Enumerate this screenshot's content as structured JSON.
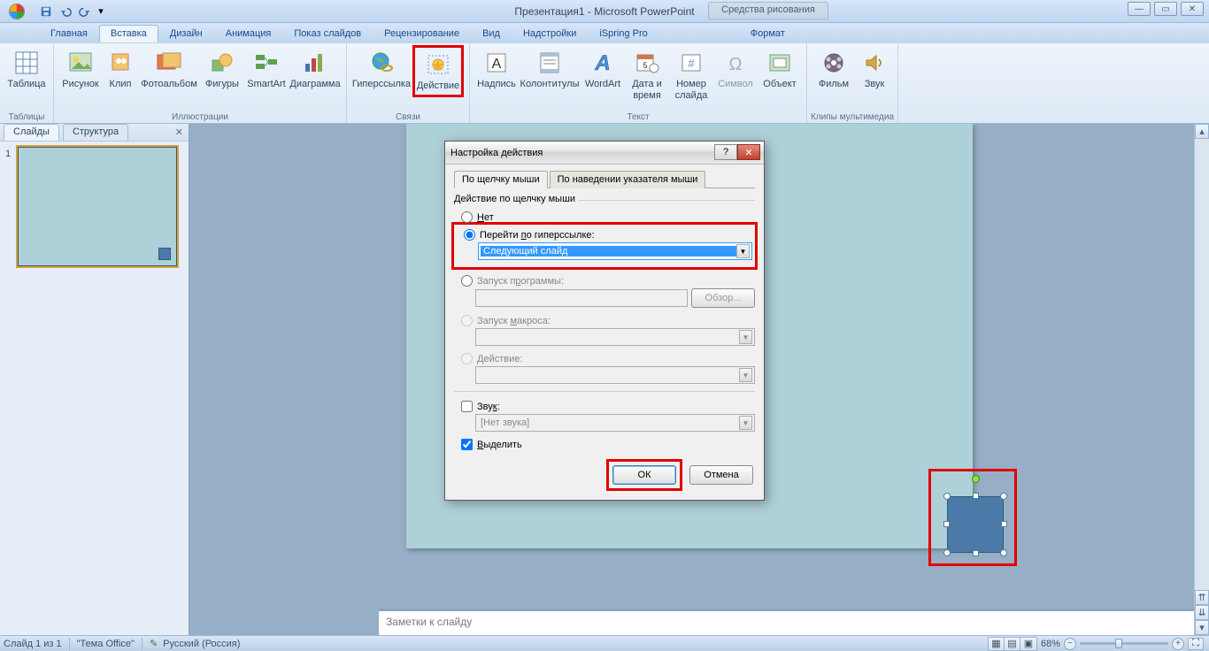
{
  "title": "Презентация1 - Microsoft PowerPoint",
  "tools_tab": "Средства рисования",
  "win": {
    "min": "—",
    "max": "▭",
    "close": "✕"
  },
  "tabs": [
    "Главная",
    "Вставка",
    "Дизайн",
    "Анимация",
    "Показ слайдов",
    "Рецензирование",
    "Вид",
    "Надстройки",
    "iSpring Pro",
    "Формат"
  ],
  "active_tab": 1,
  "ribbon": {
    "groups": [
      {
        "label": "Таблицы",
        "items": [
          {
            "name": "table",
            "label": "Таблица"
          }
        ]
      },
      {
        "label": "Иллюстрации",
        "items": [
          {
            "name": "picture",
            "label": "Рисунок"
          },
          {
            "name": "clip",
            "label": "Клип"
          },
          {
            "name": "photoalbum",
            "label": "Фотоальбом"
          },
          {
            "name": "shapes",
            "label": "Фигуры"
          },
          {
            "name": "smartart",
            "label": "SmartArt"
          },
          {
            "name": "chart",
            "label": "Диаграмма"
          }
        ]
      },
      {
        "label": "Связи",
        "items": [
          {
            "name": "hyperlink",
            "label": "Гиперссылка"
          },
          {
            "name": "action",
            "label": "Действие",
            "highlight": true
          }
        ]
      },
      {
        "label": "Текст",
        "items": [
          {
            "name": "textbox",
            "label": "Надпись"
          },
          {
            "name": "headerfooter",
            "label": "Колонтитулы"
          },
          {
            "name": "wordart",
            "label": "WordArt"
          },
          {
            "name": "datetime",
            "label": "Дата и время"
          },
          {
            "name": "slidenum",
            "label": "Номер слайда"
          },
          {
            "name": "symbol",
            "label": "Символ",
            "disabled": true
          },
          {
            "name": "object",
            "label": "Объект"
          }
        ]
      },
      {
        "label": "Клипы мультимедиа",
        "items": [
          {
            "name": "movie",
            "label": "Фильм"
          },
          {
            "name": "sound",
            "label": "Звук"
          }
        ]
      }
    ]
  },
  "left_pane": {
    "tab1": "Слайды",
    "tab2": "Структура",
    "slide_num": "1"
  },
  "notes_placeholder": "Заметки к слайду",
  "status": {
    "slide": "Слайд 1 из 1",
    "theme": "\"Тема Office\"",
    "lang": "Русский (Россия)",
    "zoom": "68%"
  },
  "dialog": {
    "title": "Настройка действия",
    "help": "?",
    "close": "✕",
    "tab_click": "По щелчку мыши",
    "tab_hover": "По наведении указателя мыши",
    "fieldset": "Действие по щелчку мыши",
    "opt_none": "Нет",
    "opt_hyperlink": "Перейти по гиперссылке:",
    "hyperlink_value": "Следующий слайд",
    "opt_program": "Запуск программы:",
    "browse": "Обзор...",
    "opt_macro": "Запуск макроса:",
    "opt_action": "Действие:",
    "sound_label": "Звук:",
    "sound_value": "[Нет звука]",
    "highlight_label": "Выделить",
    "ok": "ОК",
    "cancel": "Отмена"
  }
}
